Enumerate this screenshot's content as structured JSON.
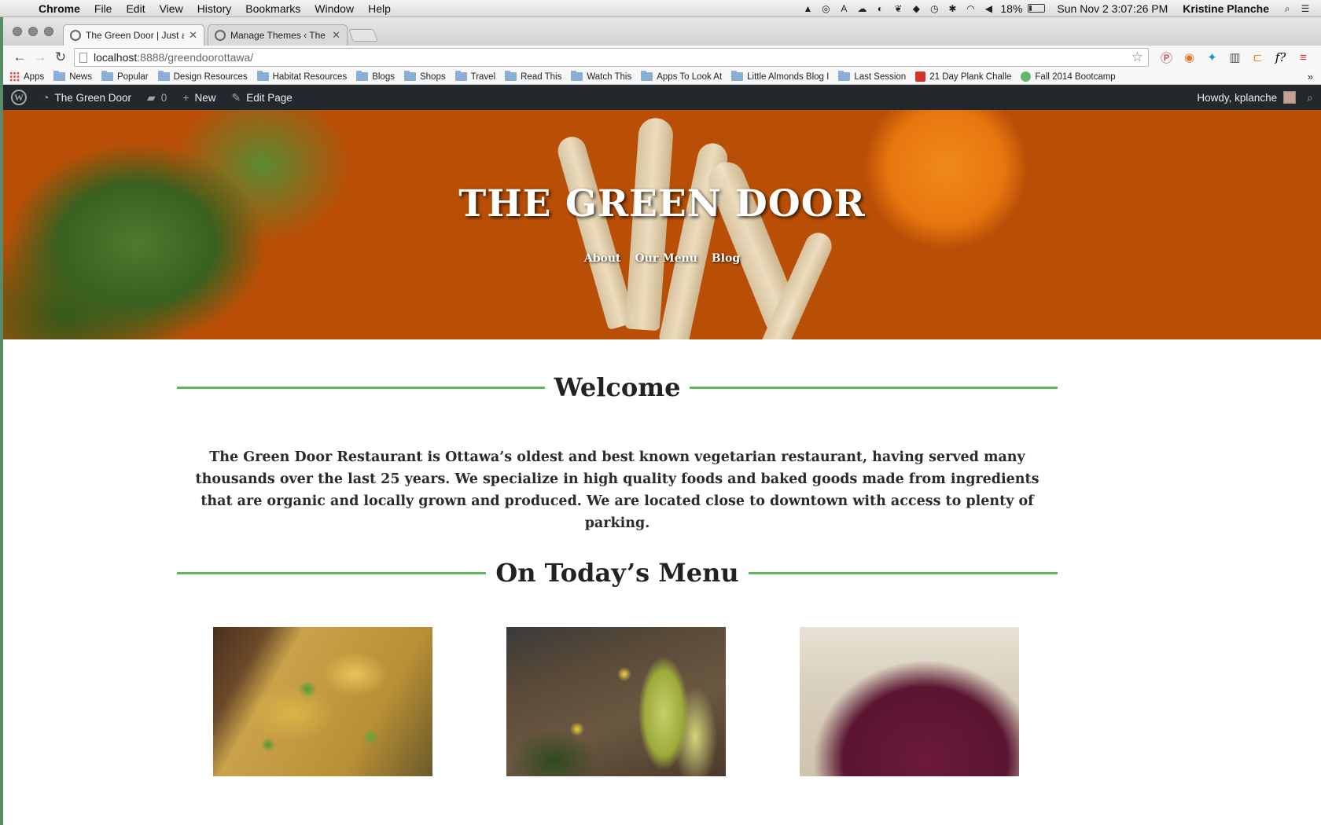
{
  "menubar": {
    "app": "Chrome",
    "items": [
      "File",
      "Edit",
      "View",
      "History",
      "Bookmarks",
      "Window",
      "Help"
    ],
    "battery": "18%",
    "clock": "Sun Nov 2  3:07:26 PM",
    "user": "Kristine Planche"
  },
  "tabs": [
    {
      "title": "The Green Door | Just anot",
      "active": true
    },
    {
      "title": "Manage Themes ‹ The Gree",
      "active": false
    }
  ],
  "address": {
    "host": "localhost",
    "rest": ":8888/greendoorottawa/"
  },
  "bookmarks": [
    {
      "label": "Apps",
      "icon": "apps-grid-icon"
    },
    {
      "label": "News",
      "icon": "folder-icon"
    },
    {
      "label": "Popular",
      "icon": "folder-icon"
    },
    {
      "label": "Design Resources",
      "icon": "folder-icon"
    },
    {
      "label": "Habitat Resources",
      "icon": "folder-icon"
    },
    {
      "label": "Blogs",
      "icon": "folder-icon"
    },
    {
      "label": "Shops",
      "icon": "folder-icon"
    },
    {
      "label": "Travel",
      "icon": "folder-icon"
    },
    {
      "label": "Read This",
      "icon": "folder-icon"
    },
    {
      "label": "Watch This",
      "icon": "folder-icon"
    },
    {
      "label": "Apps To Look At",
      "icon": "folder-icon"
    },
    {
      "label": "Little Almonds Blog I",
      "icon": "folder-icon"
    },
    {
      "label": "Last Session",
      "icon": "folder-icon"
    },
    {
      "label": "21 Day Plank Challe",
      "icon": "plank-challenge-icon"
    },
    {
      "label": "Fall 2014 Bootcamp",
      "icon": "bootcamp-icon"
    }
  ],
  "adminbar": {
    "site_name": "The Green Door",
    "comments_count": "0",
    "new_label": "New",
    "edit_label": "Edit Page",
    "howdy": "Howdy, kplanche"
  },
  "hero": {
    "title": "THE GREEN DOOR",
    "nav": [
      "About",
      "Our Menu",
      "Blog"
    ]
  },
  "welcome": {
    "heading": "Welcome",
    "text": "The Green Door Restaurant is Ottawa’s oldest and best known vegetarian restaurant, having served many thousands over the last 25 years. We specialize in high quality foods and baked goods made from ingredients that are organic and locally grown and produced. We are located close to downtown with access to plenty of parking."
  },
  "menu_section": {
    "heading": "On Today’s Menu"
  },
  "colors": {
    "accent_green": "#5cb85c",
    "admin_bar": "#23282d",
    "text": "#222222"
  }
}
